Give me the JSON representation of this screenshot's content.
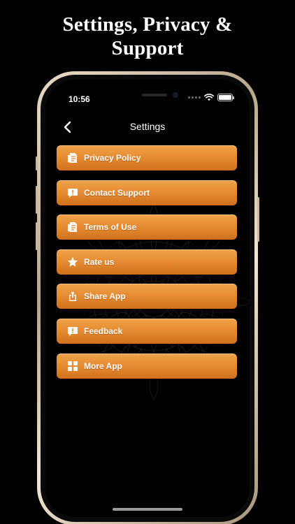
{
  "headline": {
    "line1": "Settings, Privacy &",
    "line2": "Support"
  },
  "status_bar": {
    "time": "10:56",
    "battery_level": 1.0
  },
  "nav": {
    "title": "Settings",
    "back_icon": "chevron-left-icon"
  },
  "menu": {
    "items": [
      {
        "label": "Privacy Policy",
        "icon": "document-icon"
      },
      {
        "label": "Contact Support",
        "icon": "message-alert-icon"
      },
      {
        "label": "Terms of Use",
        "icon": "document-icon"
      },
      {
        "label": "Rate us",
        "icon": "star-icon"
      },
      {
        "label": "Share App",
        "icon": "share-icon"
      },
      {
        "label": "Feedback",
        "icon": "message-alert-icon"
      },
      {
        "label": "More App",
        "icon": "grid-icon"
      }
    ]
  },
  "colors": {
    "background": "#000000",
    "button_top": "#f1a24a",
    "button_bottom": "#d0701c",
    "frame_gold": "#c9b99e"
  }
}
